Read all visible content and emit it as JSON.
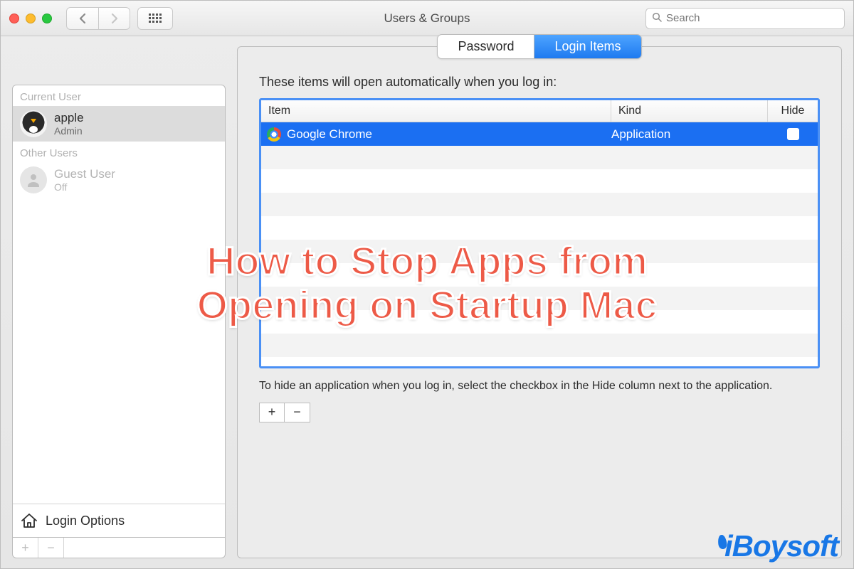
{
  "titlebar": {
    "window_title": "Users & Groups",
    "search_placeholder": "Search"
  },
  "sidebar": {
    "current_user_label": "Current User",
    "other_users_label": "Other Users",
    "login_options_label": "Login Options",
    "users": [
      {
        "name": "apple",
        "role": "Admin"
      },
      {
        "name": "Guest User",
        "role": "Off"
      }
    ],
    "add_label": "+",
    "remove_label": "−"
  },
  "tabs": {
    "password": "Password",
    "login_items": "Login Items"
  },
  "main": {
    "heading": "These items will open automatically when you log in:",
    "columns": {
      "item": "Item",
      "kind": "Kind",
      "hide": "Hide"
    },
    "rows": [
      {
        "name": "Google Chrome",
        "kind": "Application",
        "hide": false
      }
    ],
    "hint": "To hide an application when you log in, select the checkbox in the Hide column next to the application.",
    "add_label": "+",
    "remove_label": "−"
  },
  "overlay": {
    "line1": "How to Stop Apps from",
    "line2": "Opening on Startup Mac"
  },
  "watermark": "iBoysoft"
}
